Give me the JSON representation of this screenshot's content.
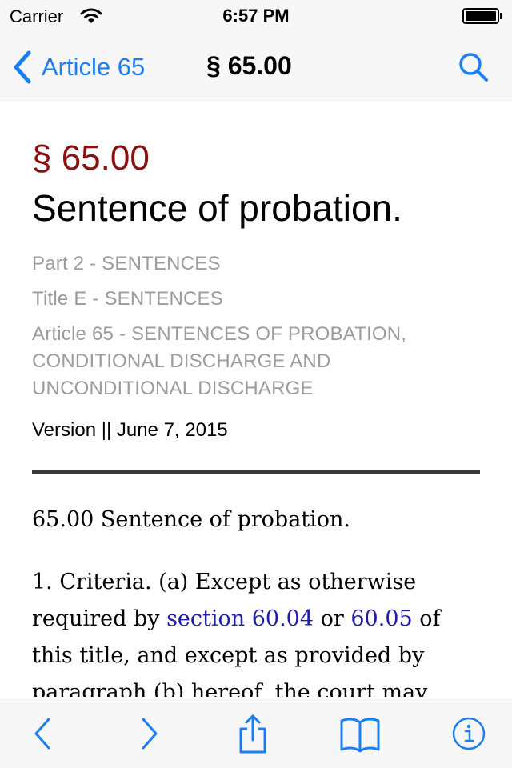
{
  "status_bar": {
    "carrier": "Carrier",
    "time": "6:57 PM"
  },
  "nav": {
    "back_label": "Article 65",
    "title": "§ 65.00"
  },
  "section": {
    "number": "§ 65.00",
    "title": "Sentence of probation."
  },
  "breadcrumbs": {
    "part": "Part 2 - SENTENCES",
    "title": "Title E - SENTENCES",
    "article": "Article 65 - SENTENCES OF PROBATION, CONDITIONAL DISCHARGE AND UNCONDITIONAL DISCHARGE"
  },
  "version": "Version || June 7, 2015",
  "body": {
    "heading": "65.00 Sentence of probation.",
    "para_1": "1. Criteria. (a) Except as otherwise required by ",
    "link_1": "section 60.04",
    "para_2": " or ",
    "link_2": "60.05",
    "para_3": " of this title, and except as provided by paragraph (b) hereof, the court may"
  },
  "colors": {
    "accent": "#1a7ef5",
    "section_number": "#8b0f0f",
    "breadcrumb": "#9c9c9c",
    "link": "#1e1ea8"
  },
  "icons": {
    "wifi": "wifi-icon",
    "battery": "battery-icon",
    "back": "chevron-left-icon",
    "search": "search-icon",
    "prev": "chevron-left-icon",
    "next": "chevron-right-icon",
    "share": "share-icon",
    "bookmarks": "book-icon",
    "info": "info-icon"
  }
}
